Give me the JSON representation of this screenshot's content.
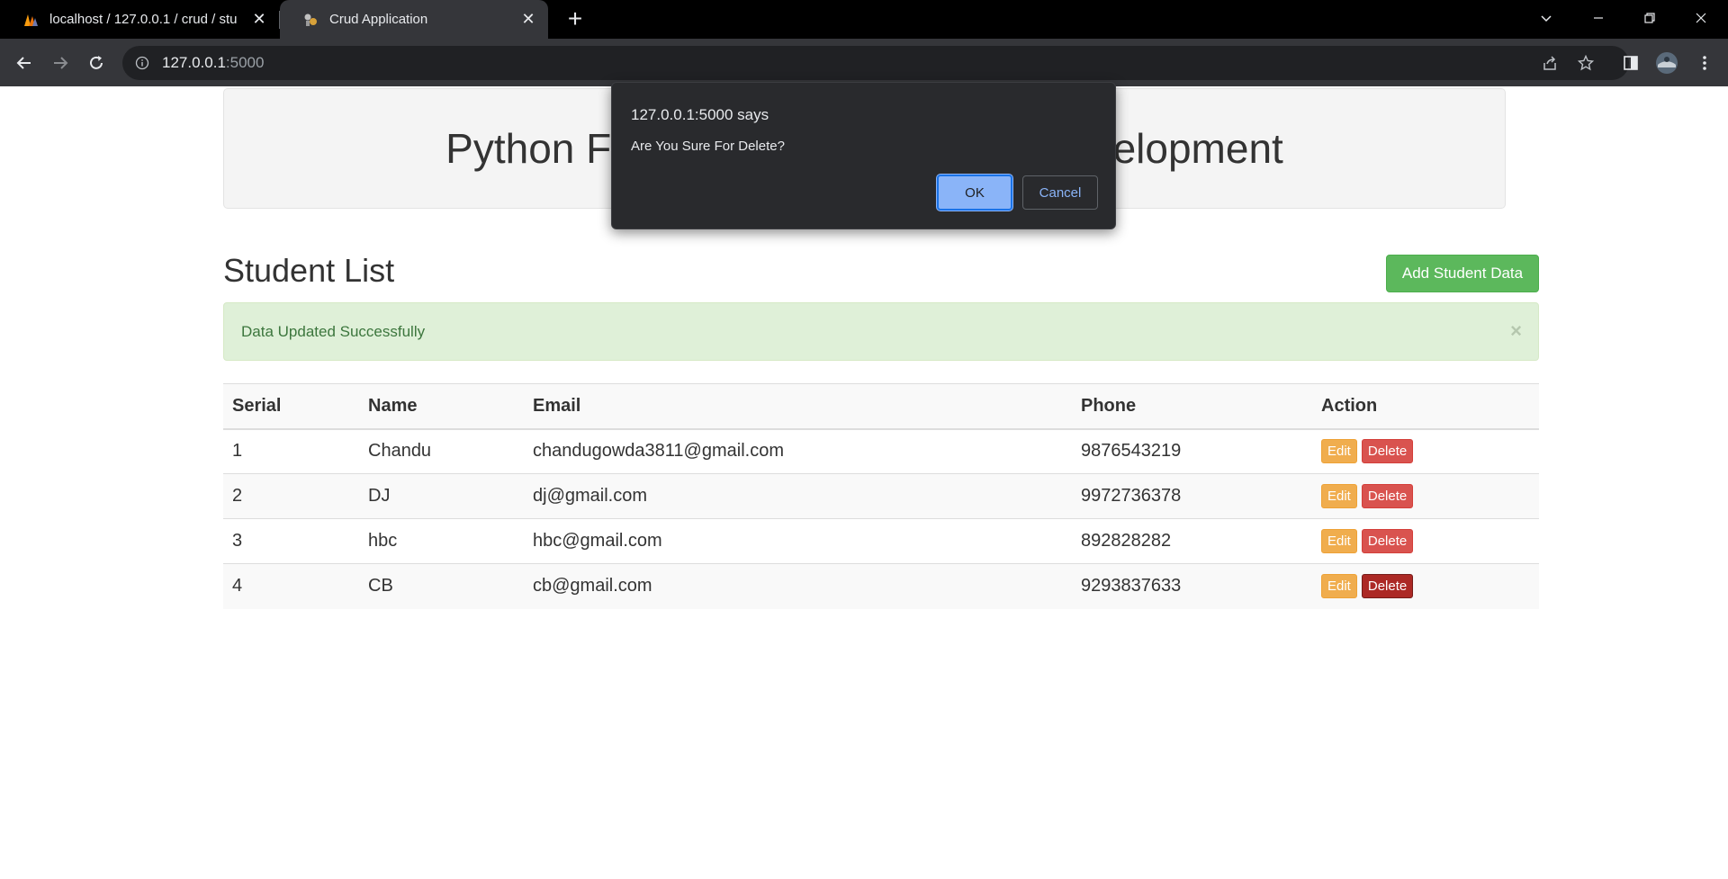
{
  "browser": {
    "tabs": [
      {
        "title": "localhost / 127.0.0.1 / crud / stu",
        "active": false
      },
      {
        "title": "Crud Application",
        "active": true
      }
    ],
    "address": {
      "host": "127.0.0.1",
      "port": ":5000"
    }
  },
  "page": {
    "banner_title": "Python Flask CRUD Application Development",
    "heading": "Student List",
    "add_button": "Add Student Data",
    "alert": {
      "message": "Data Updated Successfully",
      "close": "×"
    },
    "table": {
      "headers": [
        "Serial",
        "Name",
        "Email",
        "Phone",
        "Action"
      ],
      "rows": [
        {
          "serial": "1",
          "name": "Chandu",
          "email": "chandugowda3811@gmail.com",
          "phone": "9876543219"
        },
        {
          "serial": "2",
          "name": "DJ",
          "email": "dj@gmail.com",
          "phone": "9972736378"
        },
        {
          "serial": "3",
          "name": "hbc",
          "email": "hbc@gmail.com",
          "phone": "892828282"
        },
        {
          "serial": "4",
          "name": "CB",
          "email": "cb@gmail.com",
          "phone": "9293837633"
        }
      ],
      "edit_label": "Edit",
      "delete_label": "Delete"
    }
  },
  "dialog": {
    "origin": "127.0.0.1:5000 says",
    "message": "Are You Sure For Delete?",
    "ok": "OK",
    "cancel": "Cancel"
  },
  "colors": {
    "success_button": "#5cb85c",
    "alert_bg": "#dff0d8",
    "edit_button": "#f0ad4e",
    "delete_button": "#d9534f",
    "dialog_accent": "#8ab4f8"
  }
}
